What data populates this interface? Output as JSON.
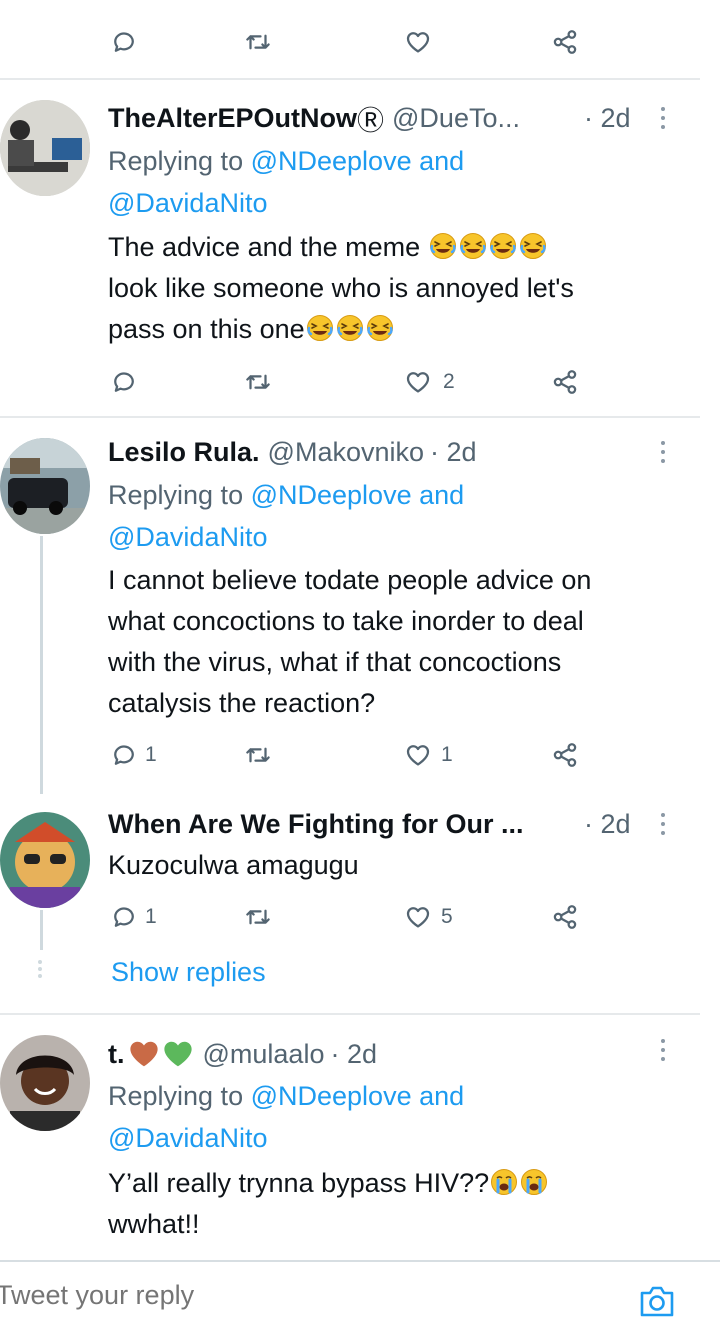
{
  "top_actions": {
    "reply_count": "",
    "retweet_count": "",
    "like_count": ""
  },
  "tweets": [
    {
      "name": "TheAlterEPOutNow",
      "badge": "Ⓡ",
      "handle": "@DueTo...",
      "time": "· 2d",
      "replying_prefix": "Replying to ",
      "replying_users_line1": "@NDeeplove and",
      "replying_users_line2": "@DavidaNito",
      "text_line1": "The advice and the meme",
      "text_line2": "look like someone who is annoyed let's",
      "text_line3": "pass on this one",
      "reply_count": "",
      "retweet_count": "",
      "like_count": "2"
    },
    {
      "name": "Lesilo Rula.",
      "handle": "@Makovniko",
      "time": "· 2d",
      "replying_prefix": "Replying to ",
      "replying_users_line1": "@NDeeplove and",
      "replying_users_line2": "@DavidaNito",
      "text_line1": "I cannot believe todate people advice on",
      "text_line2": "what concoctions to take inorder to deal",
      "text_line3": "with the virus, what if that concoctions",
      "text_line4": "catalysis the reaction?",
      "reply_count": "1",
      "retweet_count": "",
      "like_count": "1"
    },
    {
      "name": "When Are We Fighting for Our ...",
      "time": "· 2d",
      "text_line1": "Kuzoculwa amagugu",
      "reply_count": "1",
      "retweet_count": "",
      "like_count": "5",
      "show_replies": "Show replies"
    },
    {
      "name": "t.",
      "handle": "@mulaalo",
      "time": "· 2d",
      "replying_prefix": "Replying to ",
      "replying_users_line1": "@NDeeplove and",
      "replying_users_line2": "@DavidaNito",
      "text_line1": "Y’all really trynna bypass HIV??",
      "text_line2": "wwhat!!"
    }
  ],
  "reply_box": {
    "placeholder": "Tweet your reply"
  },
  "icons": {
    "reply": "reply-bubble-icon",
    "retweet": "retweet-icon",
    "like": "heart-icon",
    "share": "share-icon",
    "camera": "camera-icon"
  },
  "colors": {
    "link": "#1d9bf0",
    "muted": "#536471",
    "text": "#0f1419"
  }
}
